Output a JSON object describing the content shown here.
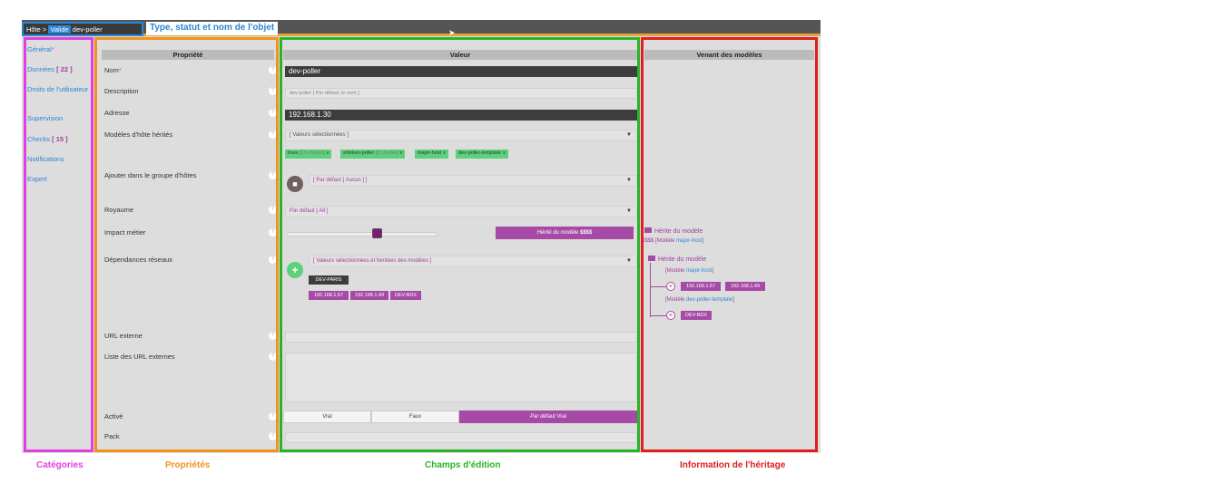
{
  "breadcrumb": {
    "host": "Hôte >",
    "status": "Valide",
    "name": "dev-poller"
  },
  "annotations": {
    "type_title": "Type, statut et nom de l'objet",
    "categories": "Catégories",
    "properties": "Propriétés",
    "edit_fields": "Champs d'édition",
    "inheritance": "Information de l'héritage"
  },
  "categories": [
    {
      "label": "Général",
      "suffix": "*"
    },
    {
      "label": "Données",
      "count": "[ 22 ]"
    },
    {
      "label": "Droits de l'utilisateur"
    },
    {
      "label": "Supervision"
    },
    {
      "label": "Checks",
      "count": "[ 15 ]"
    },
    {
      "label": "Notifications"
    },
    {
      "label": "Expert"
    }
  ],
  "headers": {
    "property": "Propriété",
    "value": "Valeur",
    "inherited": "Venant des modèles"
  },
  "properties": {
    "name": "Nom",
    "name_req": "*",
    "description": "Description",
    "address": "Adresse",
    "templates": "Modèles d'hôte hérités",
    "groups": "Ajouter dans le groupe d'hôtes",
    "realm": "Royaume",
    "impact": "Impact métier",
    "dependencies": "Dépendances réseaux",
    "url": "URL externe",
    "url_list": "Liste des URL externes",
    "enabled": "Activé",
    "pack": "Pack"
  },
  "values": {
    "name": "dev-poller",
    "description_placeholder": "dev-poller [ Par défaut, le nom ]",
    "address": "192.168.1.30",
    "templates_select": "[ Valeurs sélectionnées ]",
    "template_tags": [
      {
        "name": "linux",
        "extra": "[13 checks]"
      },
      {
        "name": "shinken-poller",
        "extra": "[2 checks]"
      },
      {
        "name": "major-host",
        "extra": ""
      },
      {
        "name": "dev-poller-template",
        "extra": ""
      }
    ],
    "groups_select": "[ Par défaut [ Aucun ] ]",
    "realm_select": "Par défaut [ All ]",
    "impact_button": "Hérité du modèle ",
    "impact_value": "$$$$",
    "impact_level": 0.6,
    "dependencies_select": "[ Valeurs sélectionnées et héritées des modèles ]",
    "dep_direct": "DEV-PARIS",
    "dep_inherited": [
      "192.168.1.57",
      "192.168.1.49",
      "DEV-BDX"
    ],
    "enabled_options": [
      "Vrai",
      "Faux"
    ],
    "enabled_default": "Par défaut",
    "enabled_default_value": "Vrai"
  },
  "inheritance": {
    "impact_label": "Hérite du modèle",
    "impact_value": "$$$$",
    "impact_model_prefix": "[Modèle",
    "impact_model": "major-host",
    "impact_model_suffix": "]",
    "dep_label": "Hérite du modèle",
    "model1_prefix": "[Modèle",
    "model1": "major-host",
    "model1_suffix": "]",
    "model1_items": [
      "192.168.1.57",
      "192.168.1.49"
    ],
    "model2_prefix": "[Modèle",
    "model2": "dev-poller-template",
    "model2_suffix": "]",
    "model2_items": [
      "DEV-BDX"
    ]
  },
  "colors": {
    "categories": "#e040e0",
    "properties": "#f0931e",
    "values": "#28b428",
    "inheritance": "#e01e1e",
    "type": "#2a86d6",
    "accent": "#a64aa6",
    "tag": "#5cd07a"
  },
  "icons": {
    "help": "help-icon",
    "cursor": "cursor-icon",
    "stop": "stop-icon",
    "add": "plus-icon",
    "caret": "chevron-down-icon"
  }
}
